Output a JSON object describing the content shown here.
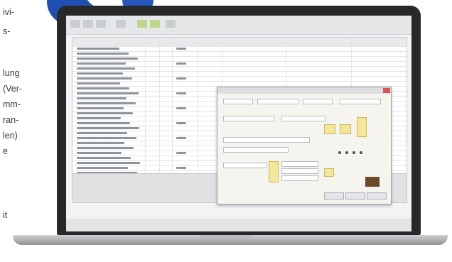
{
  "left_text": {
    "lines": [
      "ivi-",
      "s-",
      "lung",
      "(Ver-",
      "mm-",
      "ran-",
      "len)",
      "e",
      "",
      "it"
    ]
  },
  "colors": {
    "accent_blue": "#1f4fb0",
    "laptop_bezel": "#262829"
  },
  "app": {
    "window_kind": "spreadsheet",
    "dialog_kind": "form-dialog"
  }
}
